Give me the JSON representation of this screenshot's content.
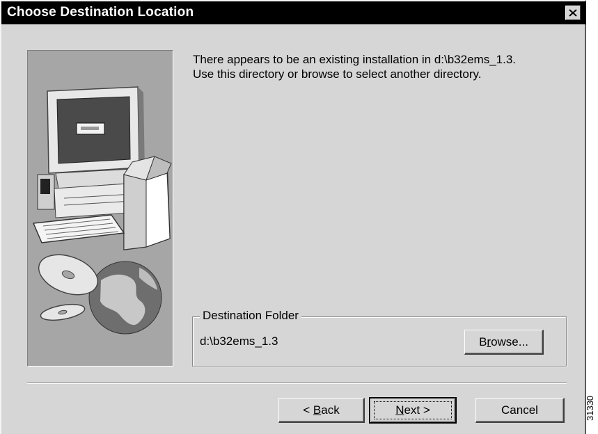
{
  "window": {
    "title": "Choose Destination Location",
    "close_icon": "close-icon"
  },
  "message": {
    "line1": "There appears to be an existing installation in d:\\b32ems_1.3.",
    "line2": "Use this directory or browse to select another directory."
  },
  "destination": {
    "group_label": "Destination Folder",
    "path": "d:\\b32ems_1.3",
    "browse_pre": "B",
    "browse_mn": "r",
    "browse_post": "owse..."
  },
  "buttons": {
    "back_pre": "< ",
    "back_mn": "B",
    "back_post": "ack",
    "next_mn": "N",
    "next_post": "ext >",
    "cancel": "Cancel"
  },
  "side_image_icon": "computer-cd-globe-illustration",
  "figure_id": "31330"
}
